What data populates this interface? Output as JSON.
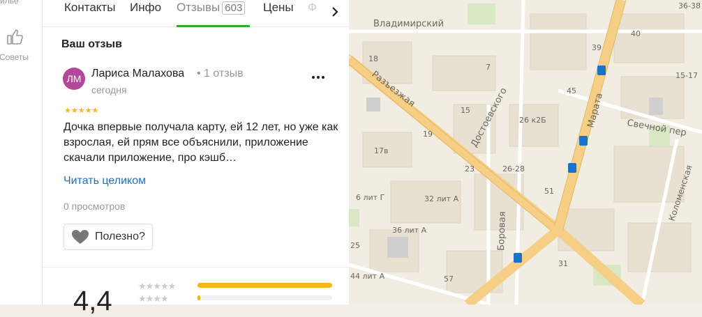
{
  "rail": {
    "top_label": "илье",
    "tips_label": "Советы"
  },
  "tabs": {
    "contacts": "Контакты",
    "info": "Инфо",
    "reviews": "Отзывы",
    "reviews_count": "603",
    "prices": "Цены",
    "next_partial": "Ф"
  },
  "review": {
    "heading": "Ваш отзыв",
    "avatar_initials": "ЛМ",
    "avatar_color": "#b3489a",
    "author": "Лариса Малахова",
    "author_meta": "• 1 отзыв",
    "date": "сегодня",
    "rating": 5,
    "stars_text": "★★★★★",
    "text": "Дочка впервые получала карту, ей 12 лет, но уже как взрослая, ей прям все объяснили, приложение скачали приложение, про кэшб…",
    "read_more": "Читать целиком",
    "views": "0 просмотров",
    "helpful": "Полезно?"
  },
  "summary": {
    "rating_value": "4,4",
    "distribution": [
      {
        "stars": 5,
        "stars_text": "★★★★★",
        "fraction": 1.0
      },
      {
        "stars": 4,
        "stars_text": "★★★★",
        "fraction": 0.02
      }
    ]
  },
  "map": {
    "labels": {
      "vladimirsky": "Владимирский",
      "razyezzhaya": "Разъезжая",
      "dostoevskogo": "Достоевского",
      "marata": "Марата",
      "svechnoy": "Свечной пер",
      "kolomenskaya": "Коломенская",
      "borovaya": "Боровая",
      "n36_38": "36-38",
      "n40": "40",
      "n39": "39",
      "n18": "18",
      "n7": "7",
      "n15_17": "15-17",
      "n45": "45",
      "n15": "15",
      "n26k2b": "26 к2Б",
      "n19": "19",
      "n17v": "17в",
      "n23": "23",
      "n26_28": "26-28",
      "n51": "51",
      "n6litG": "6 лит Г",
      "n32litA": "32 лит А",
      "n36litA": "36 лит А",
      "n25": "25",
      "n44litA": "44 лит А",
      "n57": "57",
      "n31": "31"
    }
  }
}
